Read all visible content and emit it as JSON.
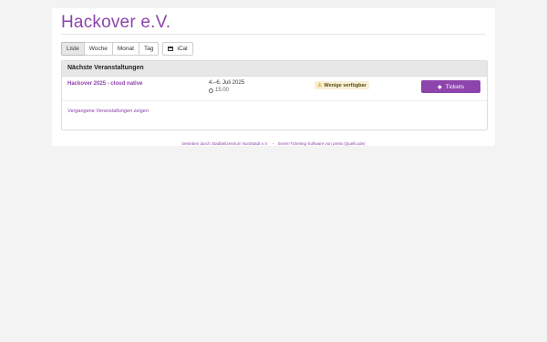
{
  "org": {
    "title": "Hackover e.V."
  },
  "views": {
    "items": [
      "Liste",
      "Woche",
      "Monat",
      "Tag"
    ],
    "active": "Liste",
    "ical_label": "iCal"
  },
  "events_panel": {
    "heading": "Nächste Veranstaltungen",
    "rows": [
      {
        "name": "Hackover 2025 - cloud native",
        "date": "4.–6. Juli 2025",
        "time": "15:00",
        "availability": "Wenige verfügbar",
        "button_label": "Tickets"
      }
    ],
    "past_link": "Vergangene Veranstaltungen zeigen"
  },
  "footer": {
    "operator_text": "betrieben durch Stadtteilzentrum Nordstadt e.V.",
    "separator": "–",
    "software_text": "Event-Ticketing-Software von pretix (Quellcode)"
  },
  "colors": {
    "accent": "#8e44ad",
    "badge_bg": "#f7f0d6",
    "warning": "#e8a400"
  },
  "icons": {
    "ical": "calendar-icon",
    "time": "clock-icon",
    "availability": "warning-icon",
    "tickets": "ticket-icon"
  }
}
